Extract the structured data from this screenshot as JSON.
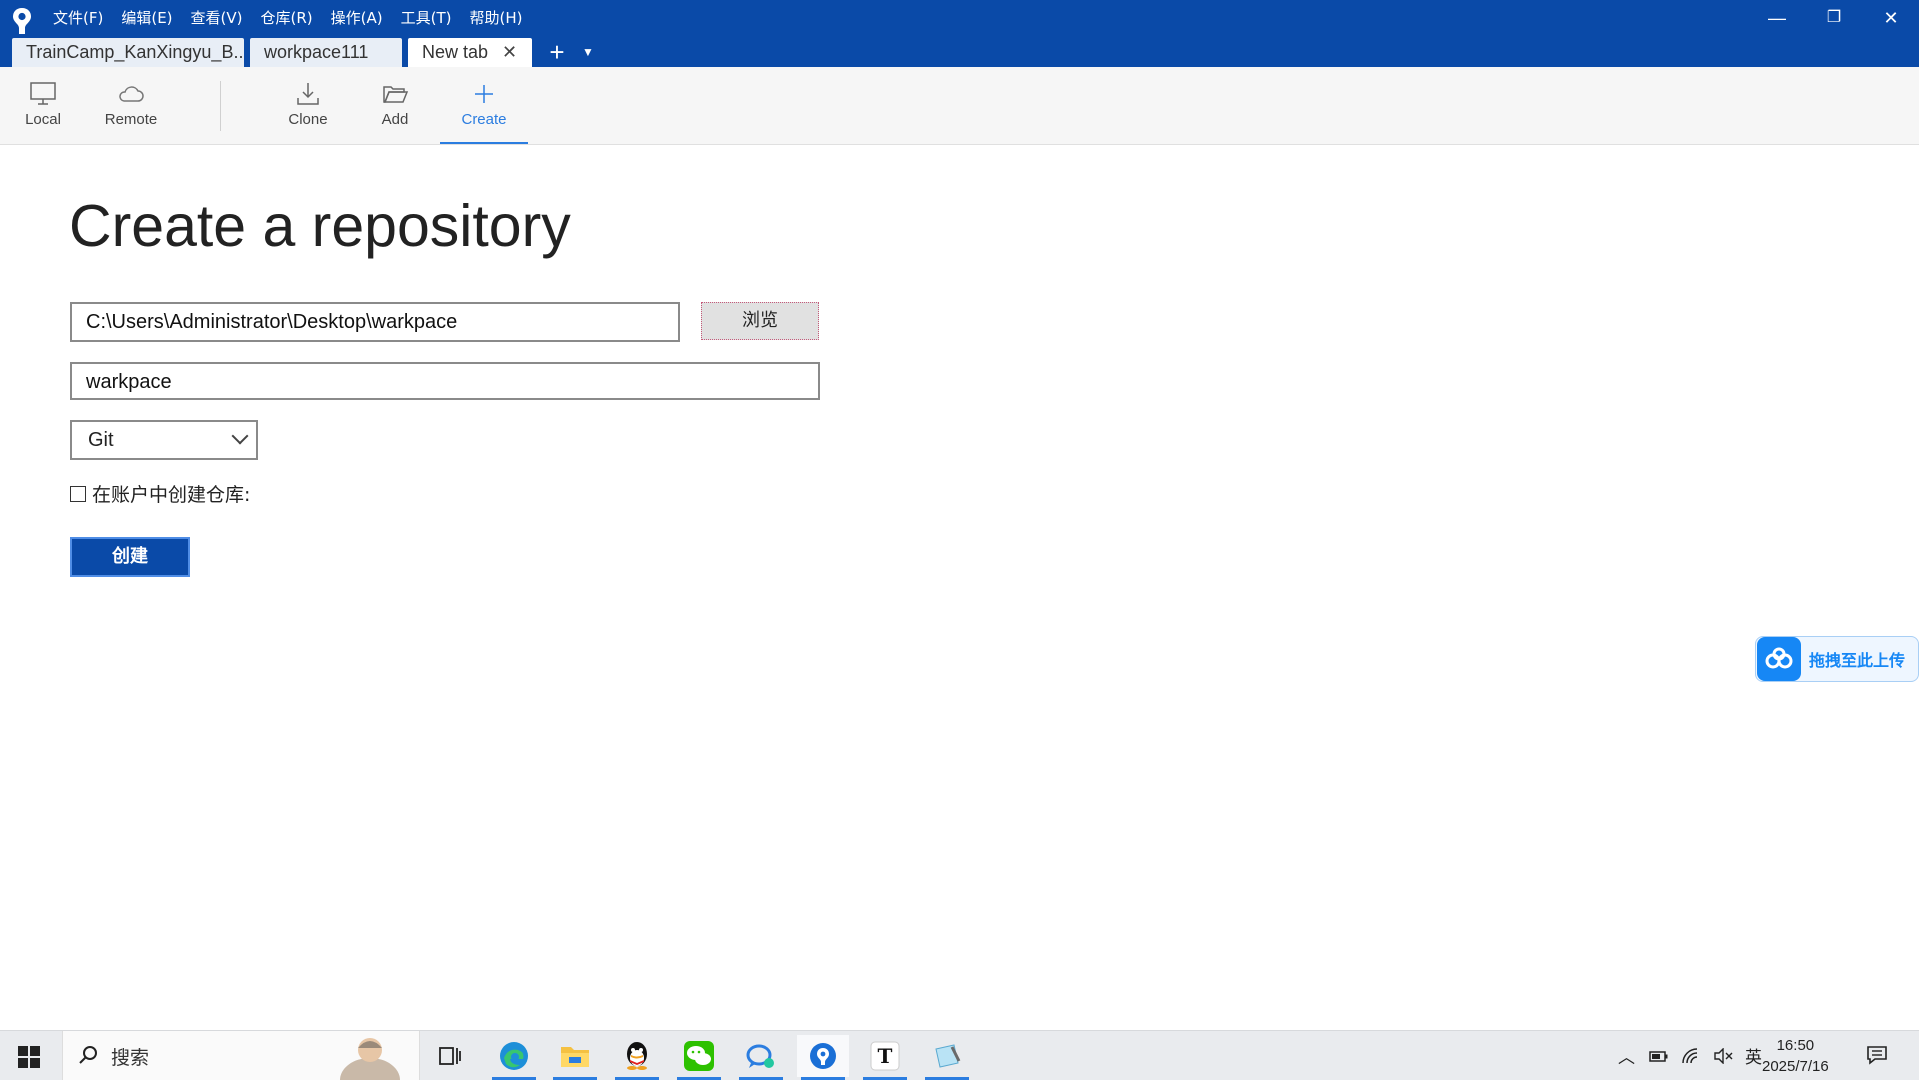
{
  "menu": [
    "文件(F)",
    "编辑(E)",
    "查看(V)",
    "仓库(R)",
    "操作(A)",
    "工具(T)",
    "帮助(H)"
  ],
  "window_controls": {
    "minimize": "—",
    "restore": "❐",
    "close": "✕"
  },
  "tabs": [
    {
      "label": "TrainCamp_KanXingyu_B..."
    },
    {
      "label": "workpace111"
    },
    {
      "label": "New tab"
    }
  ],
  "toolbar": {
    "local": "Local",
    "remote": "Remote",
    "clone": "Clone",
    "add": "Add",
    "create": "Create"
  },
  "page": {
    "title": "Create a repository",
    "path_value": "C:\\Users\\Administrator\\Desktop\\warkpace",
    "browse_label": "浏览",
    "name_value": "warkpace",
    "vcs_type": "Git",
    "checkbox_label": "在账户中创建仓库:",
    "create_label": "创建"
  },
  "upload_widget": {
    "label": "拖拽至此上传"
  },
  "taskbar": {
    "search_placeholder": "搜索",
    "clock_time": "16:50",
    "clock_date": "2025/7/16",
    "ime": "英"
  },
  "colors": {
    "titlebar": "#0a4aa8",
    "accent": "#2b7de0",
    "primary_button": "#0a4aa8"
  }
}
